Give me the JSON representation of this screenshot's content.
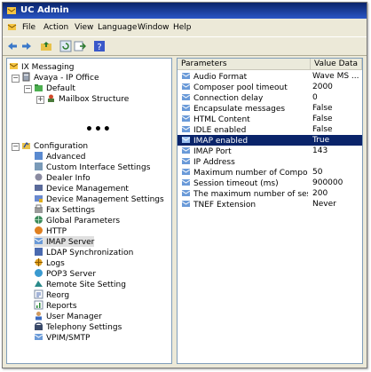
{
  "window": {
    "title": "UC Admin"
  },
  "menu": [
    "File",
    "Action",
    "View",
    "Language",
    "Window",
    "Help"
  ],
  "toolbar": {
    "buttons": [
      "back-icon",
      "forward-icon",
      "up-folder-icon",
      "refresh-icon",
      "export-icon",
      "help-icon"
    ]
  },
  "tree": {
    "root": "IX Messaging",
    "avaya": "Avaya - IP Office",
    "default": "Default",
    "mailbox": "Mailbox Structure",
    "ellipsis": "•••",
    "configuration": "Configuration",
    "items": [
      "Advanced",
      "Custom Interface Settings",
      "Dealer Info",
      "Device Management",
      "Device Management Settings",
      "Fax Settings",
      "Global Parameters",
      "HTTP",
      "IMAP Server",
      "LDAP Synchronization",
      "Logs",
      "POP3 Server",
      "Remote Site Setting",
      "Reorg",
      "Reports",
      "User Manager",
      "Telephony Settings",
      "VPIM/SMTP"
    ],
    "selected_item": "IMAP Server"
  },
  "grid": {
    "columns": [
      "Parameters",
      "Value Data"
    ],
    "rows": [
      {
        "name": "Audio Format",
        "value": "Wave MS ..."
      },
      {
        "name": "Composer pool timeout",
        "value": "2000"
      },
      {
        "name": "Connection delay",
        "value": "0"
      },
      {
        "name": "Encapsulate messages",
        "value": "False"
      },
      {
        "name": "HTML Content",
        "value": "False"
      },
      {
        "name": "IDLE enabled",
        "value": "False"
      },
      {
        "name": "IMAP enabled",
        "value": "True"
      },
      {
        "name": "IMAP Port",
        "value": "143"
      },
      {
        "name": "IP Address",
        "value": ""
      },
      {
        "name": "Maximum number of Composers",
        "value": "50"
      },
      {
        "name": "Session timeout (ms)",
        "value": "900000"
      },
      {
        "name": "The maximum number of sessi...",
        "value": "200"
      },
      {
        "name": "TNEF Extension",
        "value": "Never"
      }
    ],
    "selected_row": "IMAP enabled"
  },
  "colors": {
    "title_bar": "#0a246a",
    "selection": "#0a246a",
    "window_bg": "#ece9d8"
  }
}
